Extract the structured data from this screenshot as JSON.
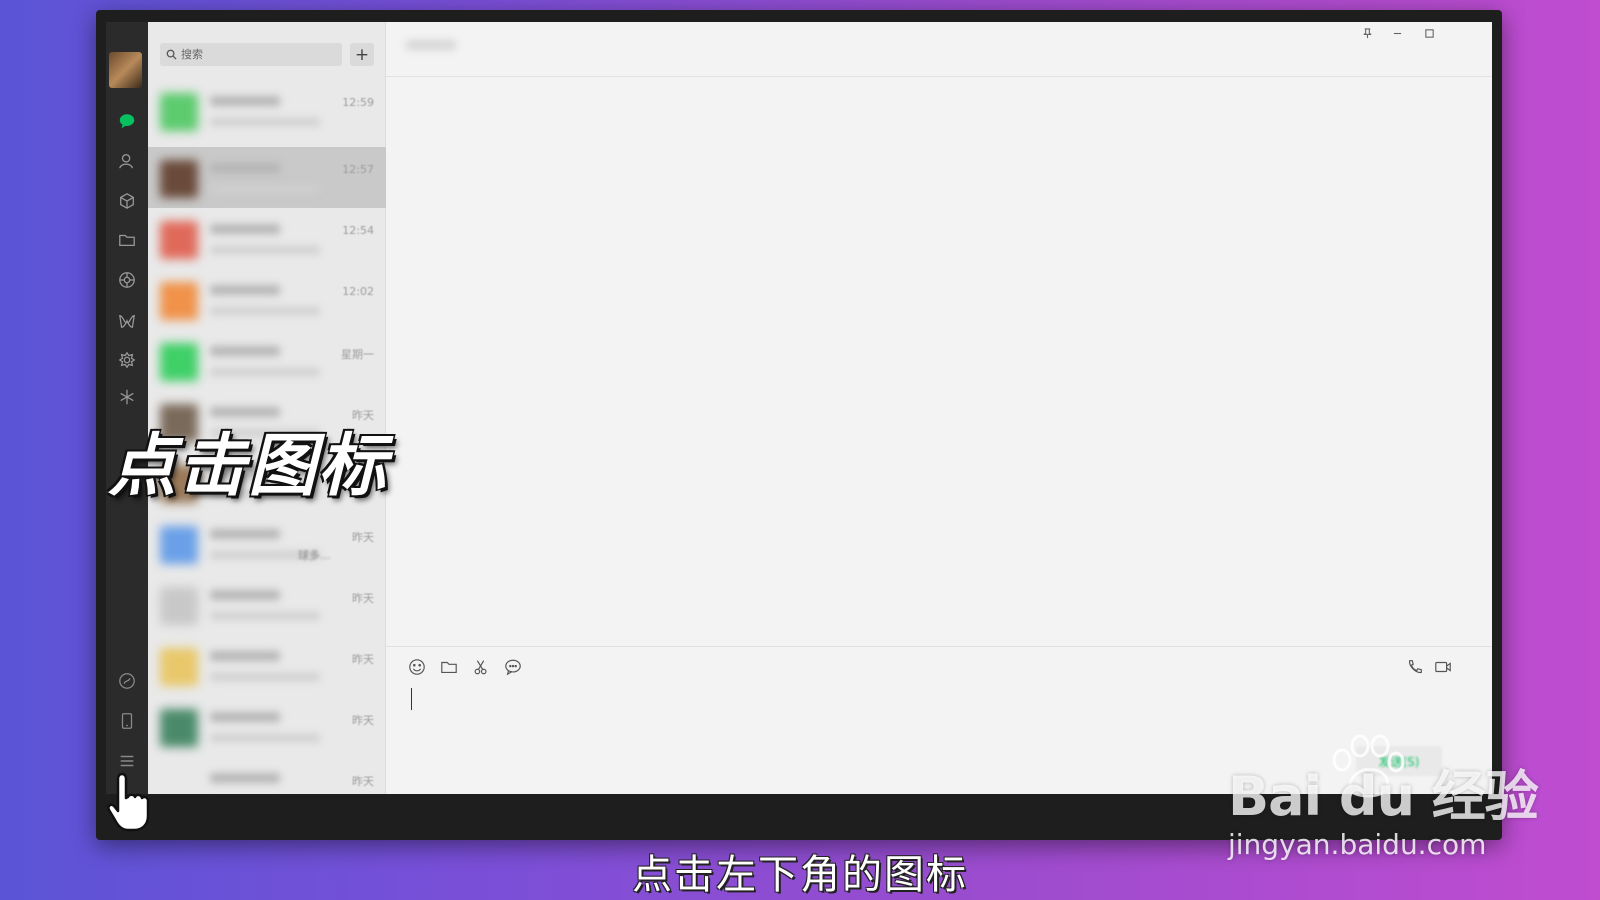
{
  "search": {
    "placeholder": "搜索"
  },
  "list": {
    "add_label": "+",
    "items": [
      {
        "time": "12:59",
        "snippet": ""
      },
      {
        "time": "12:57",
        "snippet": ""
      },
      {
        "time": "12:54",
        "snippet": ""
      },
      {
        "time": "12:02",
        "snippet": ""
      },
      {
        "time": "星期一",
        "snippet": ""
      },
      {
        "time": "昨天",
        "snippet": ""
      },
      {
        "time": "昨天",
        "snippet": "球多..."
      },
      {
        "time": "昨天",
        "snippet": ""
      },
      {
        "time": "昨天",
        "snippet": ""
      },
      {
        "time": "昨天",
        "snippet": ""
      },
      {
        "time": "昨天",
        "snippet": ""
      }
    ]
  },
  "composer": {
    "send_label": "发送(S)"
  },
  "overlay": {
    "caption": "点击图标",
    "subtitle": "点击左下角的图标"
  },
  "watermark": {
    "logo": "Bai du 经验",
    "url": "jingyan.baidu.com"
  },
  "colors": {
    "accent": "#07c160",
    "nav_bg": "#2b2b2b"
  }
}
